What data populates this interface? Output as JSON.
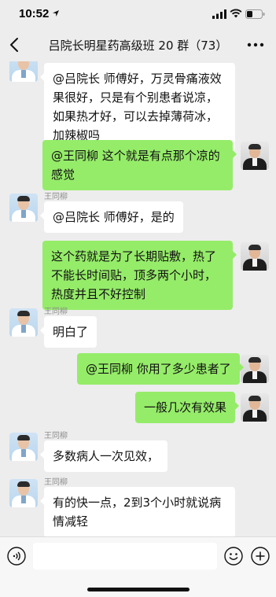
{
  "status_bar": {
    "time": "10:52",
    "icons": [
      "location-arrow-icon",
      "cellular-signal-icon",
      "wifi-icon",
      "battery-icon"
    ]
  },
  "nav": {
    "title": "吕院长明星药高级班 20 群（73）",
    "back_icon": "back-chevron-icon",
    "more_icon": "more-dots-icon"
  },
  "messages": [
    {
      "direction": "incoming",
      "text": "@吕院长 师傅好，万灵骨痛液效果很好，只是有个别患者说凉，如果热才好，可以去掉薄荷冰，加辣椒吗"
    },
    {
      "direction": "outgoing",
      "text": "@王同柳 这个就是有点那个凉的感觉"
    },
    {
      "direction": "incoming",
      "sender": "王同柳",
      "text": "@吕院长 师傅好，是的"
    },
    {
      "direction": "outgoing",
      "text": "这个药就是为了长期贴敷，热了不能长时间贴，顶多两个小时，热度并且不好控制"
    },
    {
      "direction": "incoming",
      "sender": "王同柳",
      "text": "明白了"
    },
    {
      "direction": "outgoing",
      "text": "@王同柳 你用了多少患者了"
    },
    {
      "direction": "outgoing",
      "text": "一般几次有效果"
    },
    {
      "direction": "incoming",
      "sender": "王同柳",
      "text": "多数病人一次见效，"
    },
    {
      "direction": "incoming",
      "sender": "王同柳",
      "text": "有的快一点，2到3个小时就说病情减轻"
    }
  ],
  "input_bar": {
    "voice_icon": "voice-icon",
    "emoji_icon": "emoji-icon",
    "plus_icon": "plus-icon",
    "input_value": ""
  },
  "colors": {
    "background": "#ededed",
    "incoming_bubble": "#ffffff",
    "outgoing_bubble": "#95ec69",
    "sender_text": "#8d8d8d"
  }
}
